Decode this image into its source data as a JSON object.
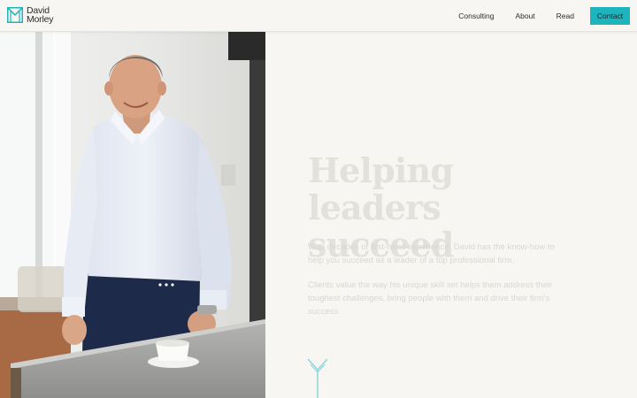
{
  "brand": {
    "name_line1": "David",
    "name_line2": "Morley",
    "accent": "#1eb4bd"
  },
  "nav": {
    "items": [
      {
        "label": "Consulting"
      },
      {
        "label": "About"
      },
      {
        "label": "Read"
      }
    ],
    "contact_label": "Contact"
  },
  "hero": {
    "headline_line1": "Helping leaders",
    "headline_line2": "succeed",
    "paragraph1": "With decades of first-hand experience, David has the know-how to help you succeed as a leader of a top professional firm.",
    "paragraph2": "Clients value the way his unique skill set helps them address their toughest challenges, bring people with them and drive their firm's success."
  },
  "icons": {
    "logo": "monogram-m-icon",
    "scroll": "scroll-down-arrow-icon"
  }
}
